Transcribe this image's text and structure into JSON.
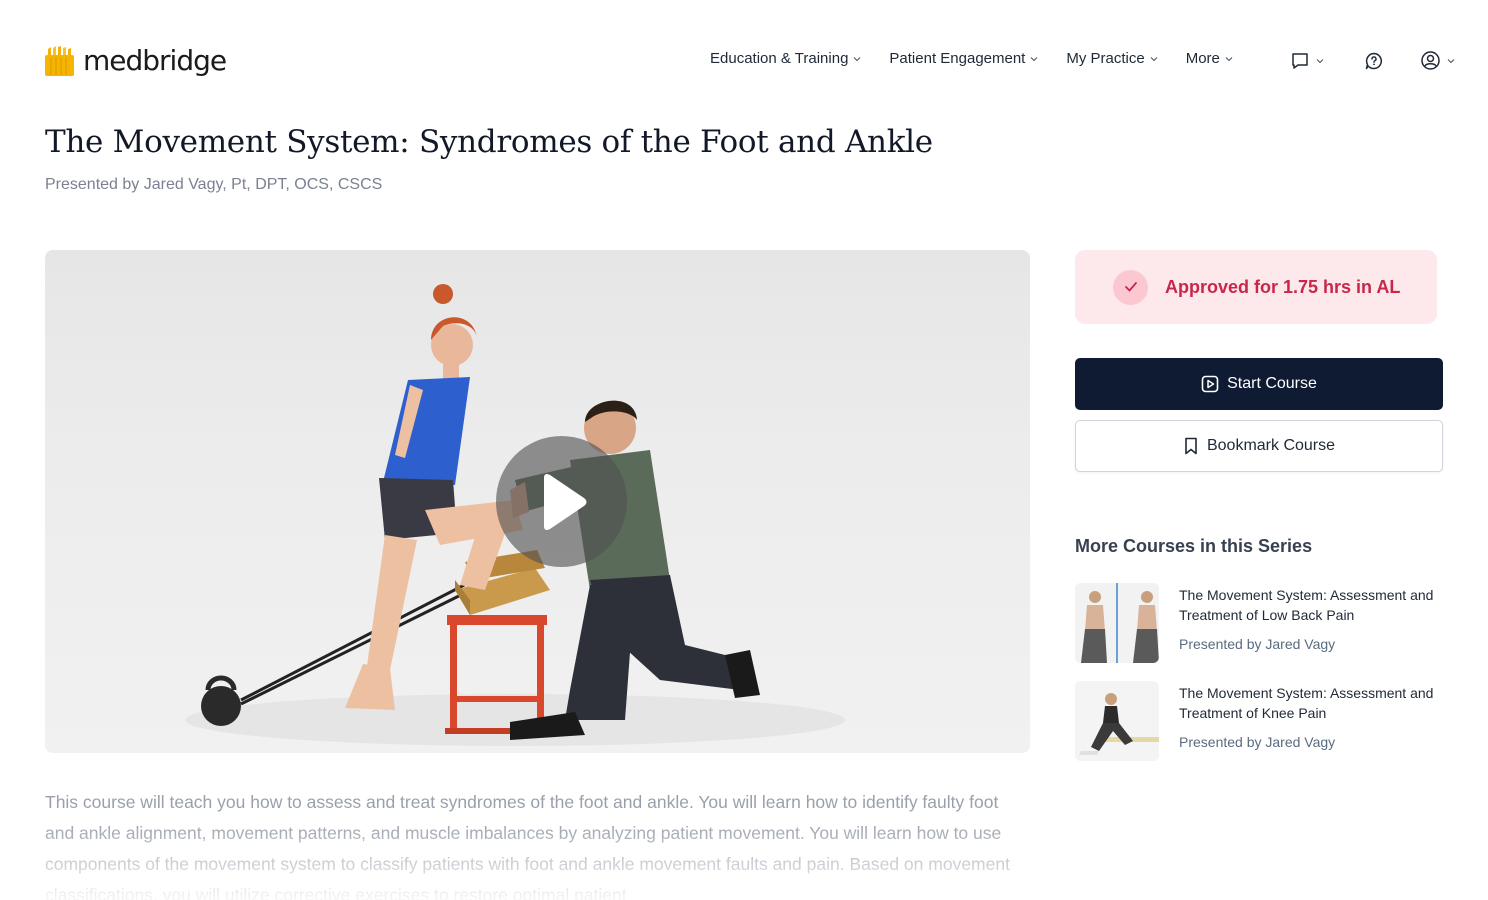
{
  "brand": {
    "name": "medbridge",
    "accent": "#f4b400"
  },
  "nav": {
    "items": [
      {
        "label": "Education & Training"
      },
      {
        "label": "Patient Engagement"
      },
      {
        "label": "My Practice"
      },
      {
        "label": "More"
      }
    ],
    "icons": [
      "chat-icon",
      "help-chat-icon",
      "user-account-icon"
    ]
  },
  "course": {
    "title": "The Movement System: Syndromes of the Foot and Ankle",
    "presenter": "Presented by Jared Vagy, Pt, DPT, OCS, CSCS",
    "description": "This course will teach you how to assess and treat syndromes of the foot and ankle. You will learn how to identify faulty foot and ankle alignment, movement patterns, and muscle imbalances by analyzing patient movement. You will learn how to use components of the movement system to classify patients with foot and ankle movement faults and pain. Based on movement classifications, you will utilize corrective exercises to restore optimal patient"
  },
  "sidebar": {
    "approved_text": "Approved for 1.75 hrs in AL",
    "start_label": "Start Course",
    "bookmark_label": "Bookmark Course",
    "series_title": "More Courses in this Series",
    "series": [
      {
        "title": "The Movement System: Assessment and Treatment of Low Back Pain",
        "presenter": "Presented by Jared Vagy"
      },
      {
        "title": "The Movement System: Assessment and Treatment of Knee Pain",
        "presenter": "Presented by Jared Vagy"
      }
    ]
  },
  "colors": {
    "primary_button": "#0f1a33",
    "approved_bg": "#fde8ec",
    "approved_text": "#c8274a"
  }
}
